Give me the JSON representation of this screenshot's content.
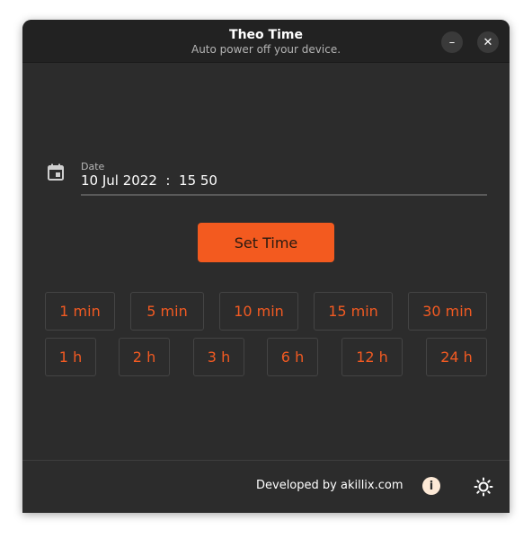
{
  "window": {
    "title": "Theo Time",
    "subtitle": "Auto power off your device.",
    "minimize_glyph": "–",
    "close_glyph": "✕"
  },
  "date": {
    "label": "Date",
    "value": "10 Jul 2022  :  15 50",
    "icon": "calendar-icon"
  },
  "set_time_label": "Set Time",
  "presets_row1": [
    "1 min",
    "5 min",
    "10 min",
    "15 min",
    "30 min"
  ],
  "presets_row2": [
    "1 h",
    "2 h",
    "3 h",
    "6 h",
    "12 h",
    "24 h"
  ],
  "footer": {
    "developer_text": "Developed by akillix.com",
    "info_glyph": "i",
    "info_icon": "info-icon",
    "theme_icon": "sun-icon"
  },
  "colors": {
    "accent": "#f35a1f",
    "window_bg": "#2c2c2c",
    "titlebar_bg": "#222222",
    "preset_text": "#f25a22"
  }
}
